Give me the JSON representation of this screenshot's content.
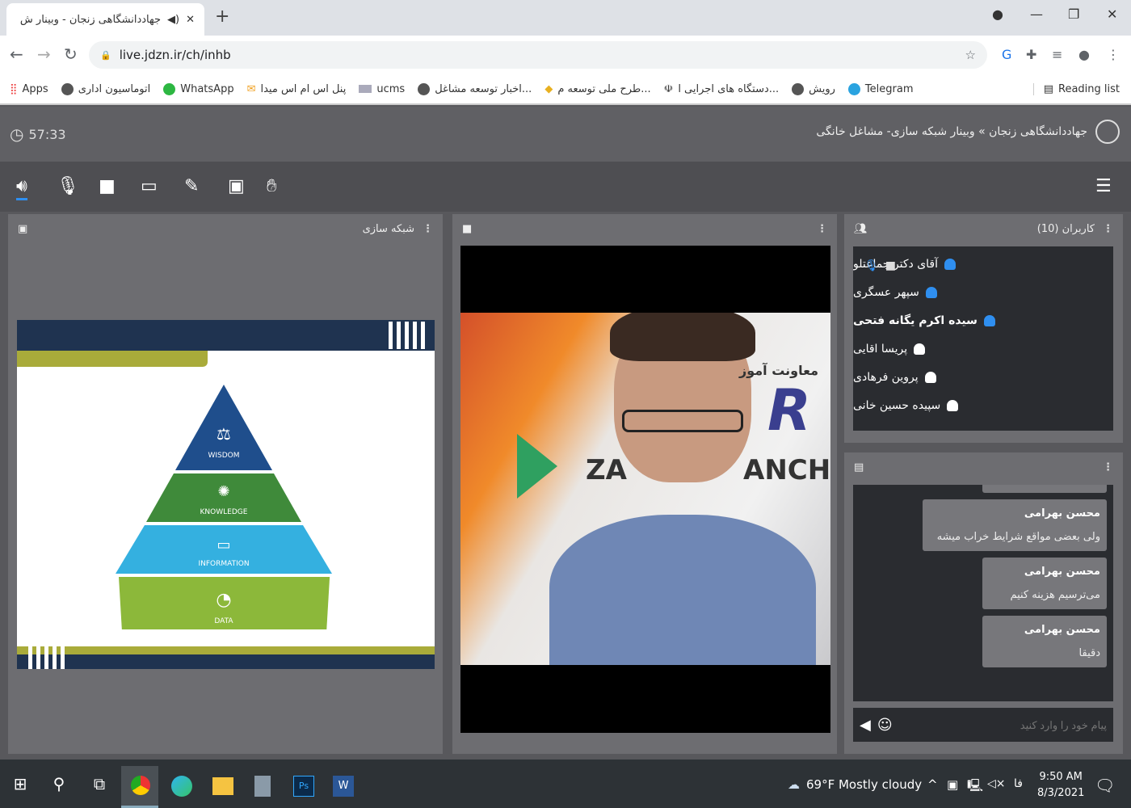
{
  "browser": {
    "tab_title": "جهاددانشگاهی زنجان - وبینار ش",
    "url": "live.jdzn.ir/ch/inhb",
    "bookmarks": [
      "Apps",
      "اتوماسیون اداری",
      "WhatsApp",
      "پنل اس ام اس میدا",
      "ucms",
      "اخبار توسعه مشاغل...",
      "طرح ملی توسعه م...",
      "دستگاه های اجرایی ا...",
      "رویش",
      "Telegram"
    ],
    "reading_list": "Reading list"
  },
  "app": {
    "breadcrumb": "جهاددانشگاهی زنجان » وبینار شبکه سازی- مشاغل خانگی",
    "timer": "57:33",
    "presentation_title": "شبکه سازی",
    "slide_labels": [
      "WISDOM",
      "KNOWLEDGE",
      "INFORMATION",
      "DATA"
    ],
    "users_title": "کاربران (10)",
    "users": [
      {
        "name": "آقای دکتر جماعتلو",
        "color": "#2f8ff0",
        "bold": false
      },
      {
        "name": "سپهر عسگری",
        "color": "#2f8ff0",
        "bold": false
      },
      {
        "name": "سیده اکرم یگانه فتحی",
        "color": "#2f8ff0",
        "bold": true
      },
      {
        "name": "پریسا اقایی",
        "color": "#ffffff",
        "bold": false
      },
      {
        "name": "پروین فرهادی",
        "color": "#ffffff",
        "bold": false
      },
      {
        "name": "سپیده حسین خانی",
        "color": "#ffffff",
        "bold": false
      }
    ],
    "chat": [
      {
        "sender": "محسن بهرامی",
        "text": "ولی بعضی مواقع شرایط خراب میشه"
      },
      {
        "sender": "محسن بهرامی",
        "text": "می‌ترسیم هزینه کنیم"
      },
      {
        "sender": "محسن بهرامی",
        "text": "دقیقا"
      }
    ],
    "chat_placeholder": "پیام خود را وارد کنید",
    "video_backdrop_text": [
      "معاونت آموز",
      "ZA",
      "ANCH",
      "R"
    ]
  },
  "taskbar": {
    "weather": "69°F  Mostly cloudy",
    "lang": "فا",
    "time": "9:50 AM",
    "date": "8/3/2021"
  }
}
